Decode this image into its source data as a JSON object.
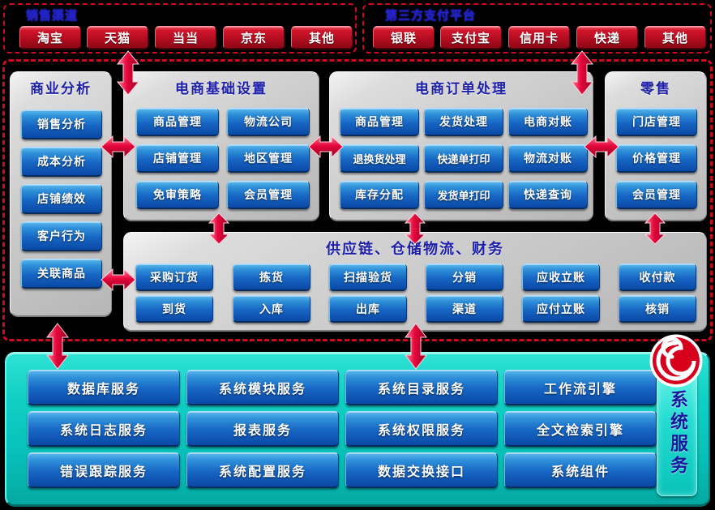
{
  "top_bars": [
    {
      "id": "sales-channel",
      "title": "销售渠道",
      "items": [
        "淘宝",
        "天猫",
        "当当",
        "京东",
        "其他"
      ]
    },
    {
      "id": "payment-platform",
      "title": "第三方支付平台",
      "items": [
        "银联",
        "支付宝",
        "信用卡",
        "快递",
        "其他"
      ]
    }
  ],
  "panels": [
    {
      "id": "business-analysis",
      "title": "商业分析",
      "items": [
        "销售分析",
        "成本分析",
        "店铺绩效",
        "客户行为",
        "关联商品"
      ]
    },
    {
      "id": "ecommerce-basic-setup",
      "title": "电商基础设置",
      "items": [
        "商品管理",
        "物流公司",
        "店铺管理",
        "地区管理",
        "免审策略",
        "会员管理"
      ]
    },
    {
      "id": "ecommerce-order-processing",
      "title": "电商订单处理",
      "items": [
        "商品管理",
        "发货处理",
        "电商对账",
        "退换货处理",
        "快递单打印",
        "物流对账",
        "库存分配",
        "发货单打印",
        "快递查询"
      ]
    },
    {
      "id": "retail",
      "title": "零售",
      "items": [
        "门店管理",
        "价格管理",
        "会员管理"
      ]
    },
    {
      "id": "supply-chain",
      "title": "供应链、仓储物流、财务",
      "items": [
        "采购订货",
        "拣货",
        "扫描验货",
        "分销",
        "应收立账",
        "收付款",
        "到货",
        "入库",
        "出库",
        "渠道",
        "应付立账",
        "核销"
      ]
    }
  ],
  "services": {
    "id": "system-services",
    "side_label": "系统服务",
    "items": [
      "数据库服务",
      "系统模块服务",
      "系统目录服务",
      "工作流引擎",
      "系统日志服务",
      "报表服务",
      "系统权限服务",
      "全文检索引擎",
      "错误跟踪服务",
      "系统配置服务",
      "数据交换接口",
      "系统组件"
    ]
  },
  "colors": {
    "frame_border": "#cf0a1e",
    "red_button": "#c21127",
    "blue_button": "#1766c4",
    "teal_panel": "#06beb6",
    "title_text": "#1f20a8",
    "background": "#000000"
  },
  "icons": {
    "logo": "red-spiral-logo",
    "arrow_vertical": "double-arrow-vertical",
    "arrow_horizontal": "double-arrow-horizontal",
    "arrow_down": "arrow-down",
    "arrow_up": "arrow-up"
  }
}
